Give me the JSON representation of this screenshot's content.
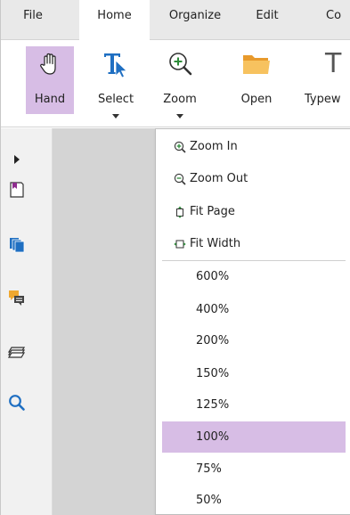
{
  "tabs": [
    "File",
    "Home",
    "Organize",
    "Edit",
    "Co"
  ],
  "active_tab": "Home",
  "ribbon": {
    "hand_label": "Hand",
    "select_label": "Select",
    "zoom_label": "Zoom",
    "open_label": "Open",
    "typewriter_label": "Typew",
    "typewriter_icon_char": "T",
    "selected_tool": "Hand"
  },
  "left_panel": {
    "items": [
      "expand-arrow-icon",
      "bookmark-icon",
      "pages-icon",
      "comments-icon",
      "layers-icon",
      "search-icon"
    ]
  },
  "zoom_menu": {
    "commands": [
      {
        "label": "Zoom In",
        "icon": "zoom-in-icon"
      },
      {
        "label": "Zoom Out",
        "icon": "zoom-out-icon"
      },
      {
        "label": "Fit Page",
        "icon": "fit-page-icon"
      },
      {
        "label": "Fit Width",
        "icon": "fit-width-icon"
      }
    ],
    "levels": [
      "600%",
      "400%",
      "200%",
      "150%",
      "125%",
      "100%",
      "75%",
      "50%"
    ],
    "selected_level": "100%"
  },
  "colors": {
    "selection": "#d7bde5",
    "accent_blue": "#1f6fc2",
    "icon_green": "#2e8b3a",
    "folder_orange": "#f2b44b",
    "comment_orange": "#f0a830"
  }
}
